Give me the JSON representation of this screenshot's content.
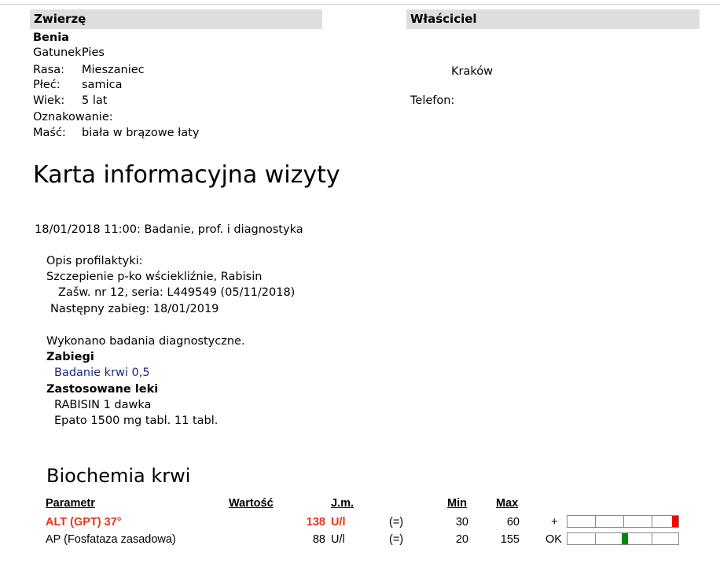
{
  "animal": {
    "header": "Zwierzę",
    "name": "Benia",
    "fields": [
      {
        "label": "Gatunek:",
        "value": "Pies"
      },
      {
        "label": "Rasa:",
        "value": "Mieszaniec"
      },
      {
        "label": "Płeć:",
        "value": "samica"
      },
      {
        "label": "Wiek:",
        "value": "5 lat"
      },
      {
        "label": "Oznakowanie:",
        "value": ""
      },
      {
        "label": "Maść:",
        "value": "biała w brązowe łaty"
      }
    ]
  },
  "owner": {
    "header": "Właściciel",
    "city": "Kraków",
    "phone_label": "Telefon:",
    "phone_value": ""
  },
  "card_title": "Karta informacyjna wizyty",
  "visit": {
    "datetime": "18/01/2018 11:00:",
    "type": "Badanie, prof. i diagnostyka",
    "prophylaxis_label": "Opis profilaktyki:",
    "vaccination": "Szczepienie p-ko wściekliźnie, Rabisin",
    "certificate": "Zašw. nr 12, seria: L449549 (05/11/2018)",
    "next_treatment": "Następny zabieg: 18/01/2019",
    "diagnostics_note": "Wykonano badania diagnostyczne.",
    "procedures_header": "Zabiegi",
    "procedures": [
      "Badanie krwi 0,5"
    ],
    "drugs_header": "Zastosowane leki",
    "drugs": [
      "RABISIN 1 dawka",
      "Epato 1500 mg tabl. 11 tabl."
    ]
  },
  "biochem": {
    "title": "Biochemia krwi",
    "columns": {
      "param": "Parametr",
      "value": "Wartość",
      "unit": "J.m.",
      "min": "Min",
      "max": "Max"
    },
    "rows": [
      {
        "param": "ALT (GPT) 37°",
        "value": "138",
        "unit": "U/l",
        "eq": "(=)",
        "min": "30",
        "max": "60",
        "flag": "+",
        "abnormal": true,
        "level": 0.97,
        "fill_color": "#ff0000"
      },
      {
        "param": "AP (Fosfataza zasadowa)",
        "value": "88",
        "unit": "U/l",
        "eq": "(=)",
        "min": "20",
        "max": "155",
        "flag": "OK",
        "abnormal": false,
        "level": 0.52,
        "fill_color": "#008a00"
      }
    ]
  }
}
